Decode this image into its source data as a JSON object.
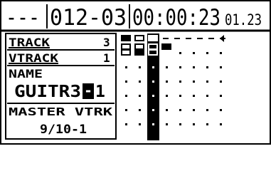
{
  "header": {
    "position_dashes": "---",
    "bar_beat_tick": "012-03",
    "timecode": "00:00:23",
    "subframes": "01.23"
  },
  "track_panel": {
    "track_label": "TRACK",
    "track_value": "3",
    "vtrack_label": "VTRACK",
    "vtrack_value": "1",
    "name_label": "NAME",
    "name_value_prefix": "GUITR3",
    "name_cursor_char": "-",
    "name_value_suffix": "1"
  },
  "master_panel": {
    "label": "MASTER VTRK",
    "value": "9/10-1"
  },
  "grid": {
    "columns": 8,
    "rows": 7,
    "selected_column": 3,
    "selected_row": 1
  }
}
